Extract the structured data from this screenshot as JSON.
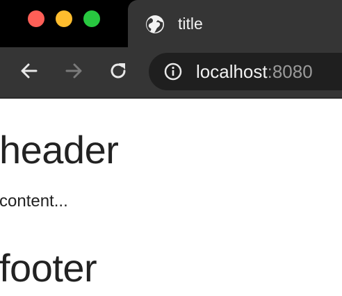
{
  "window": {
    "controls": [
      "close",
      "minimize",
      "maximize"
    ]
  },
  "tab": {
    "title": "title",
    "icon": "globe-icon"
  },
  "toolbar": {
    "back_icon": "back-arrow-icon",
    "forward_icon": "forward-arrow-icon",
    "reload_icon": "reload-icon",
    "address": {
      "info_icon": "info-icon",
      "host": "localhost",
      "port": ":8080"
    }
  },
  "page": {
    "header": "header",
    "content": "content...",
    "footer": "footer"
  },
  "colors": {
    "tab_strip": "#000000",
    "toolbar": "#353535",
    "omnibox": "#1f1f1f",
    "close": "#fe5f57",
    "minimize": "#febc2e",
    "maximize": "#28c840",
    "page_text": "#222222"
  }
}
